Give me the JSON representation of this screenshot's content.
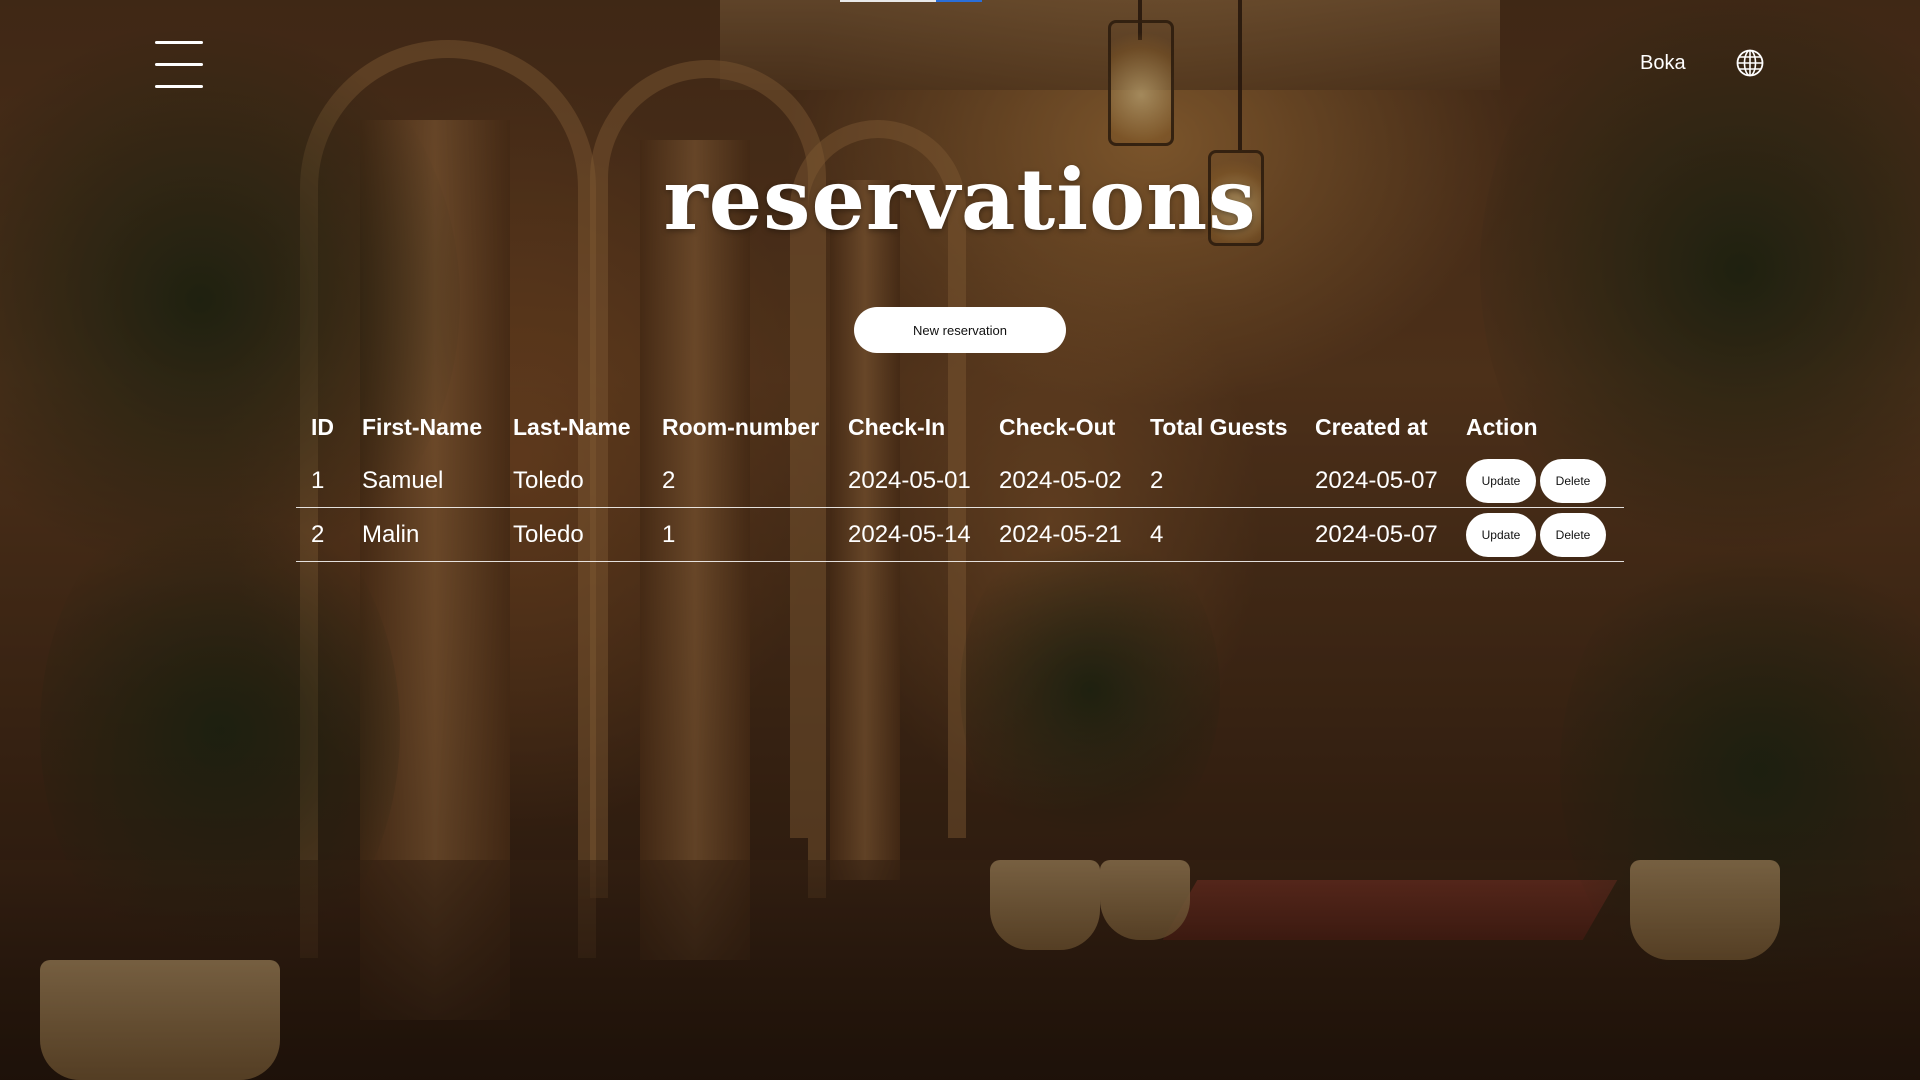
{
  "header": {
    "book_label": "Boka",
    "menu_icon": "hamburger-menu-icon",
    "language_icon": "globe-icon"
  },
  "page": {
    "title": "reservations",
    "new_reservation_label": "New reservation"
  },
  "table": {
    "columns": [
      "ID",
      "First-Name",
      "Last-Name",
      "Room-number",
      "Check-In",
      "Check-Out",
      "Total Guests",
      "Created at",
      "Action"
    ],
    "rows": [
      {
        "id": "1",
        "first_name": "Samuel",
        "last_name": "Toledo",
        "room_number": "2",
        "check_in": "2024-05-01",
        "check_out": "2024-05-02",
        "total_guests": "2",
        "created_at": "2024-05-07",
        "update_label": "Update",
        "delete_label": "Delete"
      },
      {
        "id": "2",
        "first_name": "Malin",
        "last_name": "Toledo",
        "room_number": "1",
        "check_in": "2024-05-14",
        "check_out": "2024-05-21",
        "total_guests": "4",
        "created_at": "2024-05-07",
        "update_label": "Update",
        "delete_label": "Delete"
      }
    ]
  },
  "colors": {
    "text": "#ffffff",
    "button_background": "#ffffff",
    "button_text": "#111111"
  }
}
